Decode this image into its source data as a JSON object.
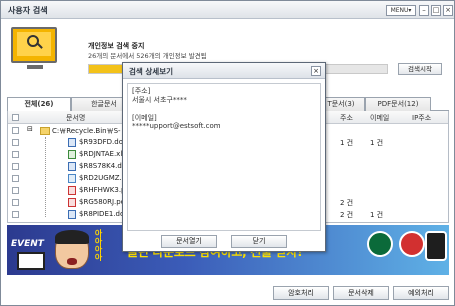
{
  "window": {
    "title": "사용자 검색",
    "menu_label": "MENU▾",
    "minimize": "–",
    "maximize": "□",
    "close": "×"
  },
  "scan": {
    "title": "개인정보 검색 중지",
    "subtitle": "26개의 문서에서 526개의 개인정보 발견됨",
    "progress_fraction": 0.28,
    "stop_button": "검색시작"
  },
  "tabs": [
    {
      "label": "전체(26)"
    },
    {
      "label": "한글문서"
    },
    {
      "label": "T문서(3)"
    },
    {
      "label": "PDF문서(12)"
    }
  ],
  "table": {
    "columns": [
      "문서명",
      "주소",
      "이메일",
      "IP주소"
    ],
    "folder": "C:￦Recycle.Bin￦S-",
    "rows": [
      {
        "name": "$R93DFD.doc",
        "type": "docx",
        "addr": "1 건",
        "email": "1 건",
        "ip": ""
      },
      {
        "name": "$RDJNTAE.xlsx",
        "type": "xlsx",
        "addr": "",
        "email": "",
        "ip": ""
      },
      {
        "name": "$R8S78K4.docx",
        "type": "docx",
        "addr": "",
        "email": "",
        "ip": ""
      },
      {
        "name": "$RD2UGMZ.hwp",
        "type": "hwp",
        "addr": "",
        "email": "",
        "ip": ""
      },
      {
        "name": "$RHFHWK3.pdf",
        "type": "pdf",
        "addr": "",
        "email": "",
        "ip": ""
      },
      {
        "name": "$RG580RJ.pdf",
        "type": "pdf",
        "addr": "2 건",
        "email": "",
        "ip": ""
      },
      {
        "name": "$R8PIDE1.docx",
        "type": "docx",
        "addr": "2 건",
        "email": "1 건",
        "ip": ""
      }
    ]
  },
  "banner": {
    "tag": "EVENT",
    "yaya": "아아아아",
    "headline": "클린 다운로드 참여하고, 선물 받자!"
  },
  "buttons": {
    "encrypt": "암호처리",
    "delete": "문서삭제",
    "exclude": "예외처리"
  },
  "modal": {
    "title": "검색 상세보기",
    "close": "×",
    "lines": [
      "[주소]",
      "서울시 서초구****",
      "",
      "[이메일]",
      "*****upport@estsoft.com"
    ],
    "open_button": "문서열기",
    "close_button": "닫기"
  }
}
